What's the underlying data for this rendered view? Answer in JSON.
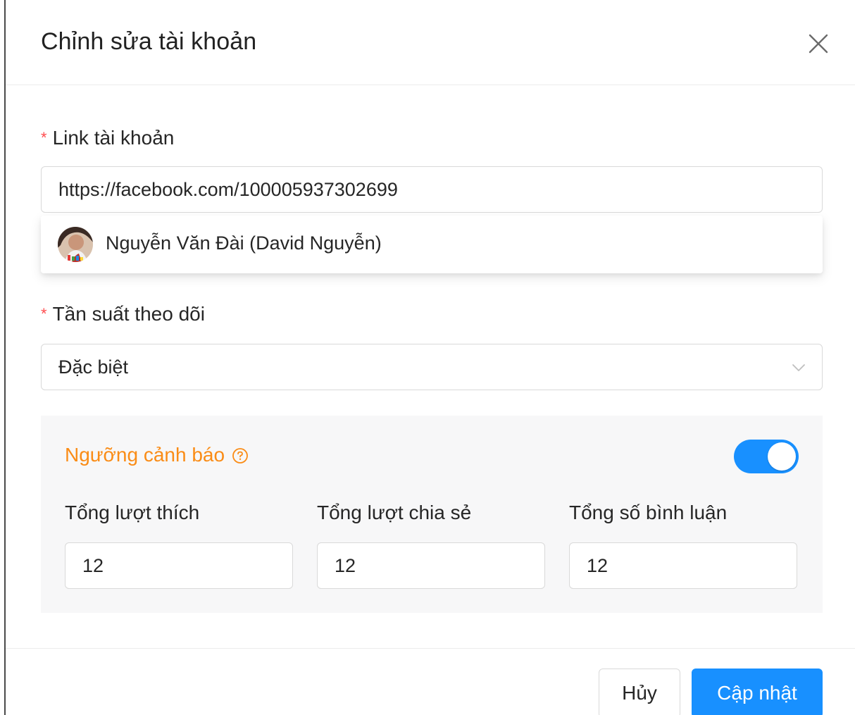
{
  "modal": {
    "title": "Chỉnh sửa tài khoản"
  },
  "form": {
    "account_link": {
      "label": "Link tài khoản",
      "required_mark": "*",
      "value": "https://facebook.com/100005937302699"
    },
    "suggestion": {
      "name": "Nguyễn Văn Đài (David Nguyễn)"
    },
    "frequency": {
      "label": "Tần suất theo dõi",
      "required_mark": "*",
      "value": "Đặc biệt"
    },
    "threshold": {
      "title": "Ngưỡng cảnh báo",
      "enabled": true,
      "accent_color": "#fa8c16",
      "toggle_color": "#1890ff",
      "metrics": [
        {
          "label": "Tổng lượt thích",
          "value": "12"
        },
        {
          "label": "Tổng lượt chia sẻ",
          "value": "12"
        },
        {
          "label": "Tổng số bình luận",
          "value": "12"
        }
      ]
    }
  },
  "footer": {
    "cancel_label": "Hủy",
    "submit_label": "Cập nhật"
  },
  "icons": {
    "close": "close-icon",
    "select_arrow": "chevron-down-icon",
    "help": "question-circle-icon",
    "avatar": "avatar"
  }
}
